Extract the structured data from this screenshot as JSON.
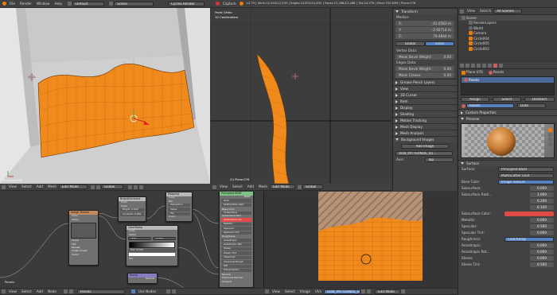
{
  "info_bar": {
    "menus": [
      "File",
      "Render",
      "Window",
      "Help"
    ],
    "layout": "Default",
    "scene": "Scene",
    "engine": "Cycles Render",
    "capture_label": "Capture",
    "stats": "v2.79 | Verts:12,545/12,545 | Edges:24,832/24,832 | Faces:12,288/12,288 | Tris:24,576 | Mem:702.83M | Plane.076"
  },
  "viewport_left": {
    "label": "(1) Plane.076"
  },
  "viewport_right": {
    "top_left_line1": "Front Ortho",
    "top_left_line2": "10 Centimeters",
    "bottom_label": "(1) Plane.076"
  },
  "vp_header": {
    "items": [
      "View",
      "Select",
      "Add",
      "Mesh"
    ],
    "mode": "Edit Mode",
    "pivot": "Global"
  },
  "transform_panel": {
    "title": "Transform",
    "median_label": "Median:",
    "x_label": "X:",
    "x_value": "-41.0583 m",
    "y_label": "Y:",
    "y_value": "-2.92714 m",
    "z_label": "Z:",
    "z_value": "79.4844 m",
    "global_label": "Global",
    "local_label": "Local",
    "vertex_data": "Vertex Data:",
    "mean_bevel_weight": "Mean Bevel Weight:",
    "mean_bevel_weight_value": "0.00",
    "edges_data": "Edges Data:",
    "mean_bevel_weight2": "Mean Bevel Weight:",
    "mean_bevel_weight2_value": "0.00",
    "mean_crease": "Mean Crease:",
    "mean_crease_value": "0.00",
    "sections": [
      "Grease Pencil Layers",
      "View",
      "3D Cursor",
      "Item",
      "Display",
      "Shading",
      "Motion Tracking",
      "Mesh Display",
      "Mesh Analysis",
      "Background Images"
    ],
    "add_image": "Add Image",
    "bg_image_name": "DDB_PATTERNDE_B1...",
    "axis_label": "Axis:",
    "axis_value": "Top"
  },
  "outliner": {
    "tabs": [
      "View",
      "Search",
      "All Scenes"
    ],
    "items": [
      "Scene",
      "RenderLayers",
      "World",
      "Camera",
      "Circle004",
      "Circle005",
      "Circle003"
    ]
  },
  "properties": {
    "breadcrumb_a": "Plane.076",
    "breadcrumb_b": "Panels",
    "material_name": "Panels",
    "link_label": "Assign",
    "select_label": "Select",
    "deselect_label": "Deselect",
    "data_label": "Panels",
    "data_dropdown": "Data",
    "custom_props": "Custom Properties",
    "preview": "Preview",
    "surface_panel": "Surface",
    "surface_label": "Surface:",
    "surface_value": "Principled BSDF",
    "multiscatter": "Multiscatter GGX",
    "base_color_label": "Base Color",
    "base_color_value": "Image Texture",
    "rows": [
      {
        "label": "Subsurface:",
        "value": "0.000"
      },
      {
        "label": "Subsurface Radi...",
        "value": "1.000"
      },
      {
        "label": "",
        "value": "0.200"
      },
      {
        "label": "",
        "value": "0.100"
      },
      {
        "label": "Subsurface Color:",
        "value": ""
      },
      {
        "label": "Metallic:",
        "value": "0.000"
      },
      {
        "label": "Specular:",
        "value": "0.500"
      },
      {
        "label": "Specular Tint:",
        "value": "0.000"
      },
      {
        "label": "Roughness:",
        "value": "ColorRamp"
      },
      {
        "label": "Anisotropic:",
        "value": "0.000"
      },
      {
        "label": "Anisotropic Rot...",
        "value": "0.000"
      },
      {
        "label": "Sheen:",
        "value": "0.000"
      },
      {
        "label": "Sheen Tint:",
        "value": "0.500"
      }
    ],
    "colors": {
      "subsurface_color": "#e14b47",
      "orange": "#f08a1c",
      "accent": "#5680c2"
    }
  },
  "node_editor": {
    "header_items": [
      "View",
      "Select",
      "Add",
      "Node"
    ],
    "material": "Panels",
    "use_nodes": "Use Nodes",
    "panel_label": "Panels",
    "nodes": {
      "image_texture": {
        "title": "Image Texture",
        "rows": [
          "Color",
          "Alpha",
          "Linear",
          "Flat",
          "Repeat",
          "Single Image",
          "Vector"
        ]
      },
      "bright_contrast": {
        "title": "Bright/Contrast",
        "rows": [
          "Color",
          "Color",
          "Bright: 0.000",
          "Contrast: 0.000"
        ]
      },
      "mapping": {
        "title": "Mapping",
        "rows": [
          "Color",
          "Fac",
          "Saturation",
          "Value",
          "Fac",
          "Color"
        ]
      },
      "color_ramp": {
        "title": "ColorRamp",
        "rows": [
          "Color",
          "Alpha",
          "RGB",
          "Linear",
          "Pos: 0.500",
          "Fac"
        ]
      },
      "principled": {
        "title": "Principled BSDF",
        "rows": [
          "BSDF",
          "GGX",
          "Multiscatter GGX",
          "Base Color",
          "Subsurface",
          "Subsurface Rad",
          "Subsurface Col",
          "Metallic",
          "Specular",
          "Specular Tint",
          "Roughness",
          "Anisotropic",
          "Anisotropic Rot",
          "Sheen",
          "Sheen Tint",
          "Clearcoat",
          "Clearcoat Rough",
          "IOR",
          "Transmission",
          "Normal",
          "Clearcoat Normal",
          "Tangent"
        ]
      },
      "bump": {
        "title": "Bump",
        "rows": [
          "Normal"
        ]
      }
    }
  },
  "image_editor": {
    "header_items": [
      "View",
      "Select",
      "Image",
      "UVs"
    ],
    "image_name": "DDB_PATTERNDE_B1...",
    "mode": "Edit Mode"
  }
}
